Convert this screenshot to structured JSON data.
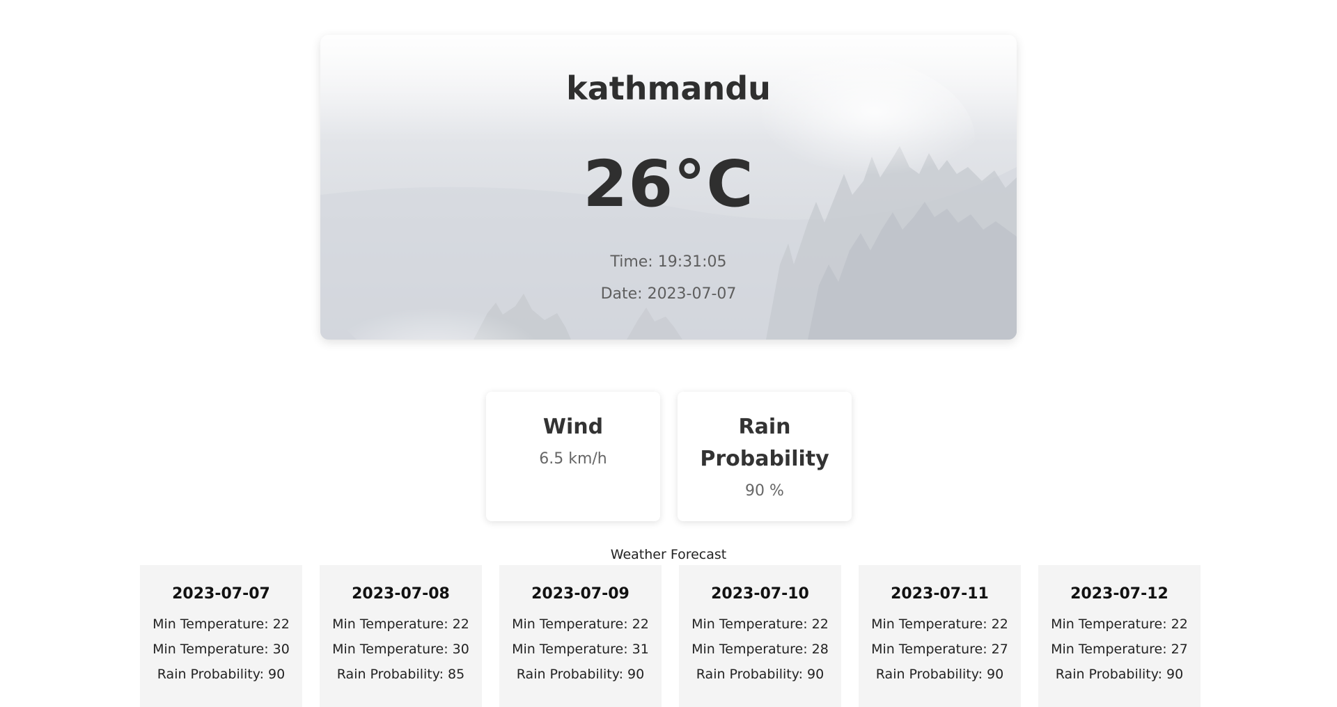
{
  "hero": {
    "city": "kathmandu",
    "temperature": "26°C",
    "time": "Time: 19:31:05",
    "date": "Date: 2023-07-07"
  },
  "info_cards": {
    "wind": {
      "title": "Wind",
      "value": "6.5 km/h"
    },
    "rain": {
      "title": "Rain Probability",
      "value": "90 %"
    }
  },
  "forecast": {
    "heading": "Weather Forecast",
    "days": [
      {
        "date": "2023-07-07",
        "min": "Min Temperature: 22",
        "max": "Min Temperature: 30",
        "rain": "Rain Probability: 90"
      },
      {
        "date": "2023-07-08",
        "min": "Min Temperature: 22",
        "max": "Min Temperature: 30",
        "rain": "Rain Probability: 85"
      },
      {
        "date": "2023-07-09",
        "min": "Min Temperature: 22",
        "max": "Min Temperature: 31",
        "rain": "Rain Probability: 90"
      },
      {
        "date": "2023-07-10",
        "min": "Min Temperature: 22",
        "max": "Min Temperature: 28",
        "rain": "Rain Probability: 90"
      },
      {
        "date": "2023-07-11",
        "min": "Min Temperature: 22",
        "max": "Min Temperature: 27",
        "rain": "Rain Probability: 90"
      },
      {
        "date": "2023-07-12",
        "min": "Min Temperature: 22",
        "max": "Min Temperature: 27",
        "rain": "Rain Probability: 90"
      }
    ]
  }
}
